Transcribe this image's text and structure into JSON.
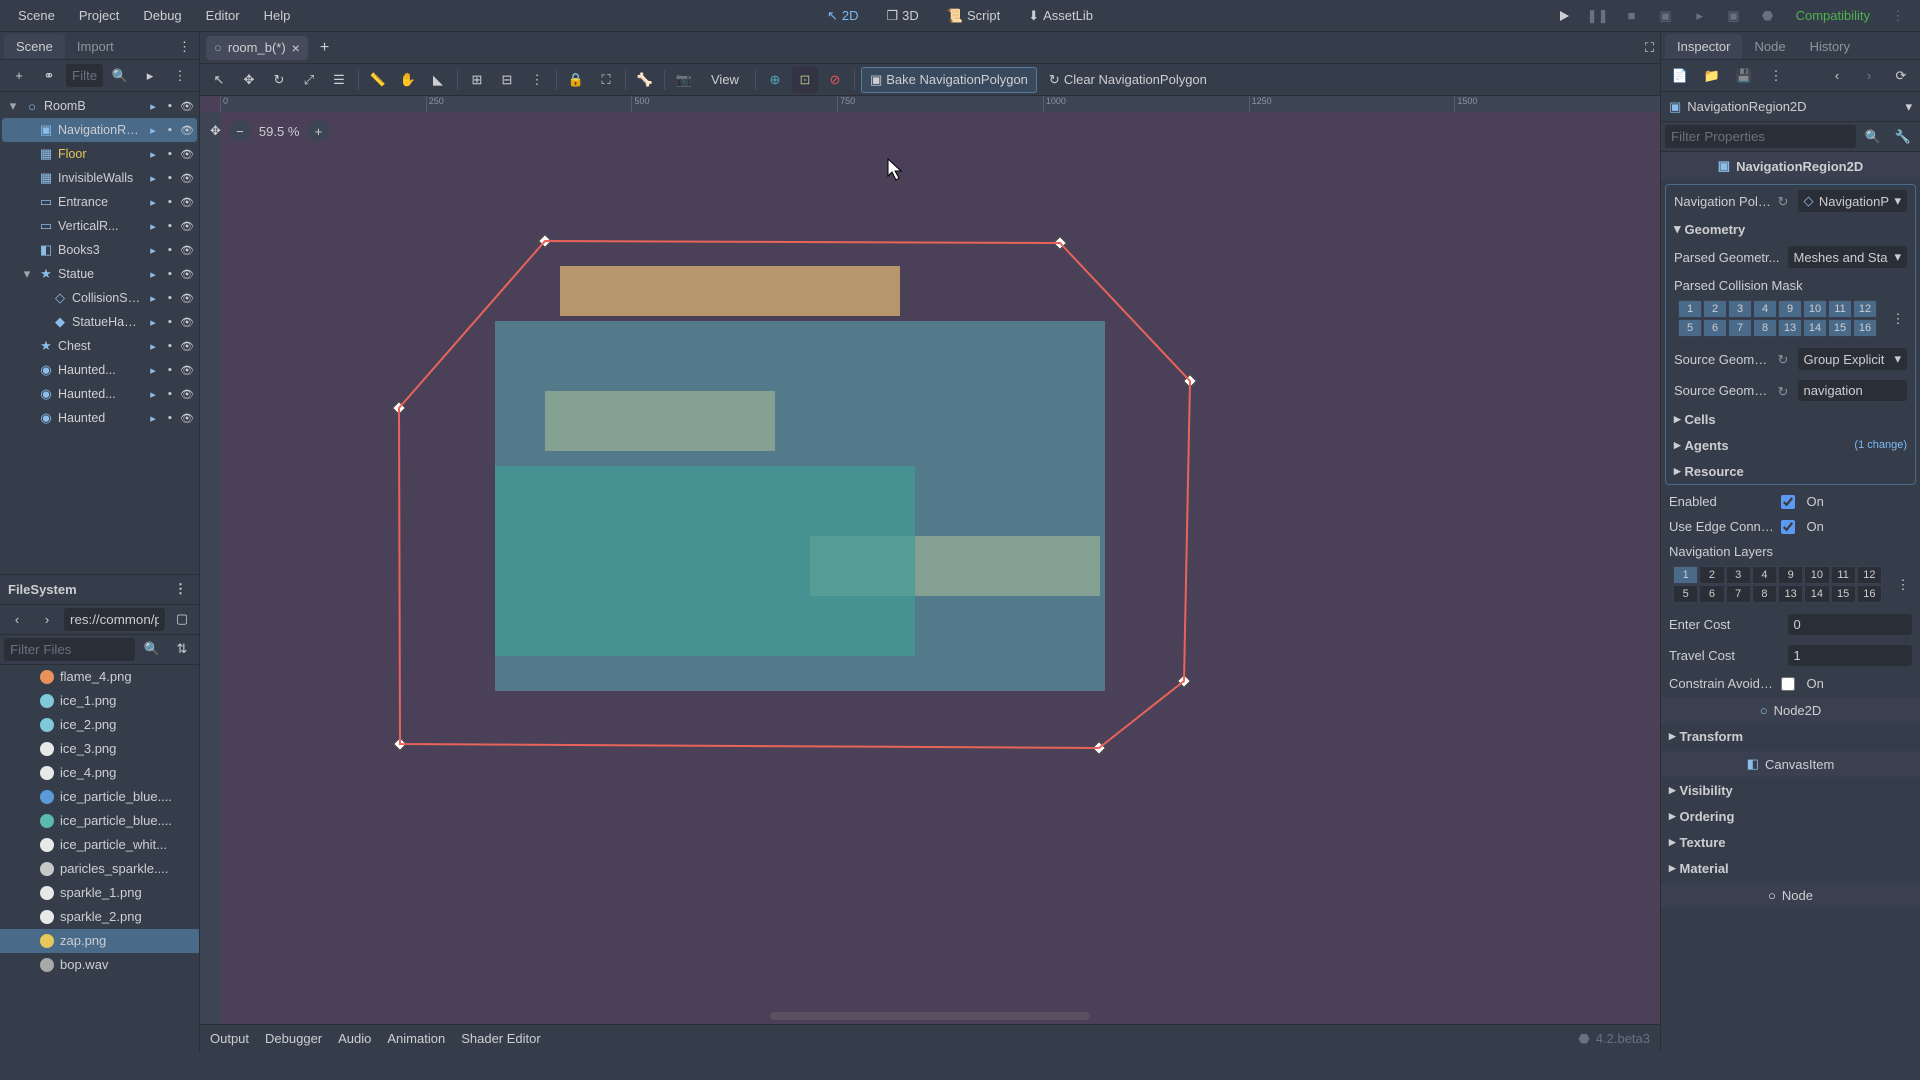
{
  "menubar": {
    "scene": "Scene",
    "project": "Project",
    "debug": "Debug",
    "editor": "Editor",
    "help": "Help"
  },
  "modes": {
    "twod": "2D",
    "threed": "3D",
    "script": "Script",
    "assetlib": "AssetLib"
  },
  "renderer": "Compatibility",
  "scene_dock": {
    "tabs": {
      "scene": "Scene",
      "import": "Import"
    },
    "filter_placeholder": "Filter: na",
    "nodes": [
      {
        "name": "RoomB",
        "depth": 0,
        "expand": "▾",
        "icon": "○",
        "sel": false
      },
      {
        "name": "NavigationRegio...",
        "depth": 1,
        "expand": "",
        "icon": "▣",
        "sel": true
      },
      {
        "name": "Floor",
        "depth": 1,
        "expand": "",
        "icon": "▦",
        "sel": false,
        "warn": true
      },
      {
        "name": "InvisibleWalls",
        "depth": 1,
        "expand": "",
        "icon": "▦",
        "sel": false
      },
      {
        "name": "Entrance",
        "depth": 1,
        "expand": "",
        "icon": "▭",
        "sel": false
      },
      {
        "name": "VerticalR...",
        "depth": 1,
        "expand": "",
        "icon": "▭",
        "sel": false
      },
      {
        "name": "Books3",
        "depth": 1,
        "expand": "",
        "icon": "◧",
        "sel": false
      },
      {
        "name": "Statue",
        "depth": 1,
        "expand": "▾",
        "icon": "★",
        "sel": false
      },
      {
        "name": "CollisionShape...",
        "depth": 2,
        "expand": "",
        "icon": "◇",
        "sel": false
      },
      {
        "name": "StatueHammer",
        "depth": 2,
        "expand": "",
        "icon": "◆",
        "sel": false
      },
      {
        "name": "Chest",
        "depth": 1,
        "expand": "",
        "icon": "★",
        "sel": false
      },
      {
        "name": "Haunted...",
        "depth": 1,
        "expand": "",
        "icon": "◉",
        "sel": false
      },
      {
        "name": "Haunted...",
        "depth": 1,
        "expand": "",
        "icon": "◉",
        "sel": false
      },
      {
        "name": "Haunted",
        "depth": 1,
        "expand": "",
        "icon": "◉",
        "sel": false
      }
    ]
  },
  "filesystem": {
    "title": "FileSystem",
    "path": "res://common/partic",
    "filter_placeholder": "Filter Files",
    "items": [
      {
        "name": "flame_4.png",
        "color": "#e8915a",
        "sel": false
      },
      {
        "name": "ice_1.png",
        "color": "#7ec8d8",
        "sel": false
      },
      {
        "name": "ice_2.png",
        "color": "#7ec8d8",
        "sel": false
      },
      {
        "name": "ice_3.png",
        "color": "#e8e8e8",
        "sel": false
      },
      {
        "name": "ice_4.png",
        "color": "#e8e8e8",
        "sel": false
      },
      {
        "name": "ice_particle_blue....",
        "color": "#5a9ad8",
        "sel": false
      },
      {
        "name": "ice_particle_blue....",
        "color": "#5abab0",
        "sel": false
      },
      {
        "name": "ice_particle_whit...",
        "color": "#e8e8e8",
        "sel": false
      },
      {
        "name": "paricles_sparkle....",
        "color": "#c8c8c8",
        "sel": false
      },
      {
        "name": "sparkle_1.png",
        "color": "#e8e8e8",
        "sel": false
      },
      {
        "name": "sparkle_2.png",
        "color": "#e8e8e8",
        "sel": false
      },
      {
        "name": "zap.png",
        "color": "#e8c85a",
        "sel": true
      },
      {
        "name": "bop.wav",
        "color": "#a8a8a8",
        "sel": false
      }
    ]
  },
  "scene_tabs": {
    "room_b": "room_b(*)"
  },
  "viewport": {
    "view_label": "View",
    "bake": "Bake NavigationPolygon",
    "clear": "Clear NavigationPolygon",
    "zoom": "59.5 %",
    "ruler_marks": [
      "0",
      "250",
      "500",
      "750",
      "1000",
      "1250",
      "1500"
    ]
  },
  "inspector": {
    "tabs": {
      "inspector": "Inspector",
      "node": "Node",
      "history": "History"
    },
    "node_type": "NavigationRegion2D",
    "filter_placeholder": "Filter Properties",
    "class_label": "NavigationRegion2D",
    "nav_poly": {
      "label": "Navigation Poly...",
      "value": "NavigationP"
    },
    "geometry_header": "Geometry",
    "parsed_geom": {
      "label": "Parsed Geometr...",
      "value": "Meshes and Sta"
    },
    "parsed_collision": "Parsed Collision Mask",
    "collision_layers": [
      "1",
      "2",
      "3",
      "4",
      "9",
      "10",
      "11",
      "12",
      "5",
      "6",
      "7",
      "8",
      "13",
      "14",
      "15",
      "16"
    ],
    "source_geom": {
      "label": "Source Geome...",
      "value": "Group Explicit"
    },
    "source_geom2": {
      "label": "Source Geome...",
      "value": "navigation"
    },
    "cells": "Cells",
    "agents": "Agents",
    "agents_change": "(1 change)",
    "resource": "Resource",
    "enabled": {
      "label": "Enabled",
      "value": "On"
    },
    "use_edge": {
      "label": "Use Edge Connecti...",
      "value": "On"
    },
    "nav_layers_label": "Navigation Layers",
    "nav_layers": [
      "1",
      "2",
      "3",
      "4",
      "9",
      "10",
      "11",
      "12",
      "5",
      "6",
      "7",
      "8",
      "13",
      "14",
      "15",
      "16"
    ],
    "enter_cost": {
      "label": "Enter Cost",
      "value": "0"
    },
    "travel_cost": {
      "label": "Travel Cost",
      "value": "1"
    },
    "constrain": {
      "label": "Constrain Avoidan...",
      "value": "On"
    },
    "node2d": "Node2D",
    "transform": "Transform",
    "canvasitem": "CanvasItem",
    "visibility": "Visibility",
    "ordering": "Ordering",
    "texture": "Texture",
    "material": "Material",
    "node_class": "Node"
  },
  "bottom": {
    "output": "Output",
    "debugger": "Debugger",
    "audio": "Audio",
    "animation": "Animation",
    "shader": "Shader Editor",
    "version": "4.2.beta3"
  }
}
